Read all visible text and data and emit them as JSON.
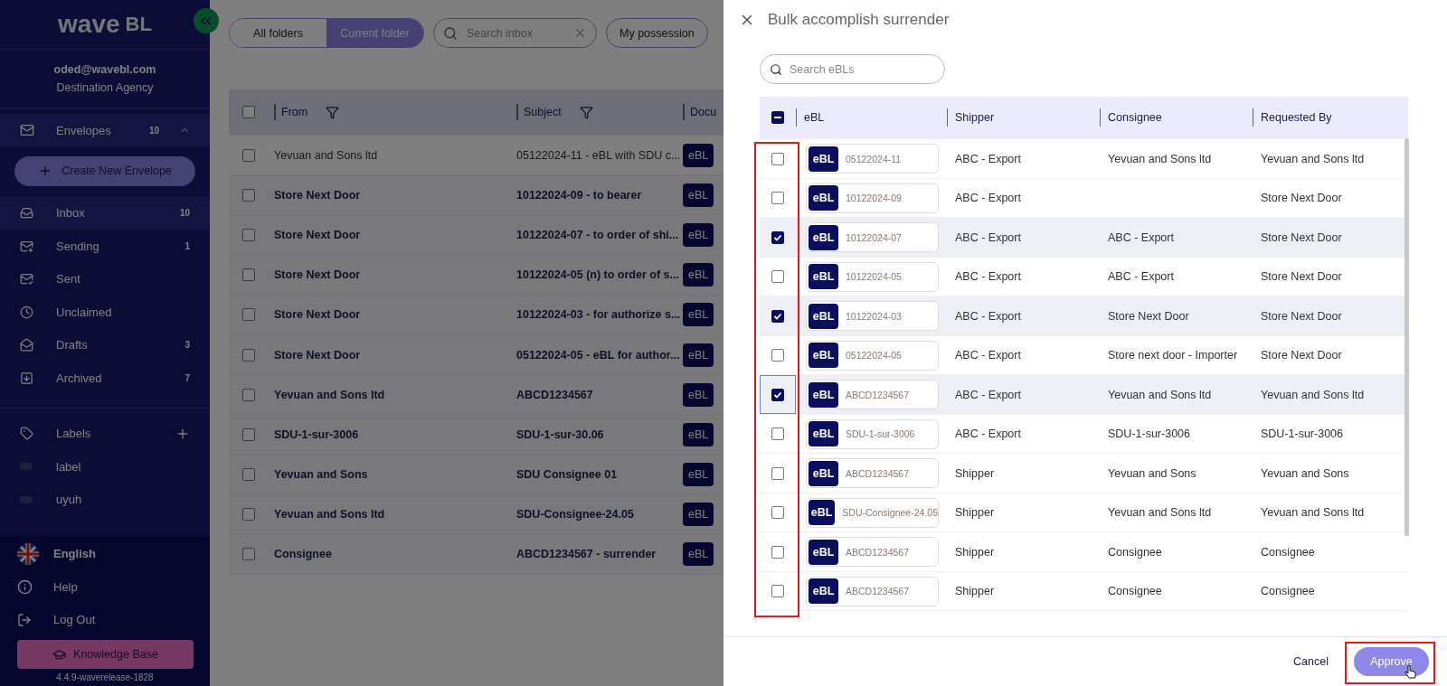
{
  "sidebar": {
    "logo": {
      "word": "wave",
      "suffix": "BL"
    },
    "user": {
      "email": "oded@wavebl.com",
      "organization": "Destination Agency"
    },
    "envelopes": {
      "label": "Envelopes",
      "count": "10",
      "expanded": true
    },
    "create_button": "Create New Envelope",
    "folders": [
      {
        "label": "Inbox",
        "count": "10",
        "selected": true
      },
      {
        "label": "Sending",
        "count": "1",
        "selected": false
      },
      {
        "label": "Sent",
        "selected": false
      },
      {
        "label": "Unclaimed",
        "selected": false
      },
      {
        "label": "Drafts",
        "count": "3",
        "selected": false
      },
      {
        "label": "Archived",
        "count": "7",
        "selected": false
      }
    ],
    "labels": {
      "title": "Labels",
      "items": [
        "label",
        "uyuh"
      ]
    },
    "footer": [
      "English",
      "Help",
      "Log Out"
    ],
    "knowledge_base": "Knowledge Base",
    "version": "4.4.9-waverelease-1828"
  },
  "main": {
    "scope_tabs": [
      {
        "label": "All folders",
        "selected": false
      },
      {
        "label": "Current folder",
        "selected": true
      }
    ],
    "search": {
      "placeholder": "Search inbox"
    },
    "filters": [
      "My possession"
    ],
    "table": {
      "select_all": {
        "checked": false
      },
      "columns": [
        "From",
        "Subject",
        "Docu"
      ],
      "rows": [
        {
          "from": "Yevuan and Sons ltd",
          "subject": "05122024-11 - eBL with SDU c...",
          "document": "eBL",
          "unread": false
        },
        {
          "from": "Store Next Door",
          "subject": "10122024-09 - to bearer",
          "document": "eBL",
          "unread": true
        },
        {
          "from": "Store Next Door",
          "subject": "10122024-07 - to order of shi...",
          "document": "eBL",
          "unread": true
        },
        {
          "from": "Store Next Door",
          "subject": "10122024-05 (n) to order of s...",
          "document": "eBL",
          "unread": true
        },
        {
          "from": "Store Next Door",
          "subject": "10122024-03 - for authorize s...",
          "document": "eBL",
          "unread": true
        },
        {
          "from": "Store Next Door",
          "subject": "05122024-05 - eBL for author...",
          "document": "eBL",
          "unread": true
        },
        {
          "from": "Yevuan and Sons ltd",
          "subject": "ABCD1234567",
          "document": "eBL",
          "unread": true
        },
        {
          "from": "SDU-1-sur-3006",
          "subject": "SDU-1-sur-30.06",
          "document": "eBL",
          "unread": true
        },
        {
          "from": "Yevuan and Sons",
          "subject": "SDU Consignee 01",
          "document": "eBL",
          "unread": true
        },
        {
          "from": "Yevuan and Sons ltd",
          "subject": "SDU-Consignee-24.05",
          "document": "eBL",
          "unread": true
        },
        {
          "from": "Consignee",
          "subject": "ABCD1234567 - surrender",
          "document": "eBL",
          "unread": true
        }
      ]
    }
  },
  "dialog": {
    "title": "Bulk accomplish surrender",
    "search": {
      "placeholder": "Search eBLs"
    },
    "select_all": {
      "indeterminate": true
    },
    "columns": [
      "eBL",
      "Shipper",
      "Consignee",
      "Requested By"
    ],
    "rows": [
      {
        "checked": false,
        "focused": false,
        "type": "eBL",
        "number": "05122024-11",
        "shipper": "ABC - Export",
        "consignee": "Yevuan and Sons ltd",
        "requested_by": "Yevuan and Sons ltd"
      },
      {
        "checked": false,
        "focused": false,
        "type": "eBL",
        "number": "10122024-09",
        "shipper": "ABC - Export",
        "requested_by": "Store Next Door"
      },
      {
        "checked": true,
        "focused": false,
        "type": "eBL",
        "number": "10122024-07",
        "shipper": "ABC - Export",
        "consignee": "ABC - Export",
        "requested_by": "Store Next Door"
      },
      {
        "checked": false,
        "focused": false,
        "type": "eBL",
        "number": "10122024-05",
        "shipper": "ABC - Export",
        "consignee": "ABC - Export",
        "requested_by": "Store Next Door"
      },
      {
        "checked": true,
        "focused": false,
        "type": "eBL",
        "number": "10122024-03",
        "shipper": "ABC - Export",
        "consignee": "Store Next Door",
        "requested_by": "Store Next Door"
      },
      {
        "checked": false,
        "focused": false,
        "type": "eBL",
        "number": "05122024-05",
        "shipper": "ABC - Export",
        "consignee": "Store next door - Importer",
        "requested_by": "Store Next Door"
      },
      {
        "checked": true,
        "focused": true,
        "type": "eBL",
        "number": "ABCD1234567",
        "shipper": "ABC - Export",
        "consignee": "Yevuan and Sons ltd",
        "requested_by": "Yevuan and Sons ltd"
      },
      {
        "checked": false,
        "focused": false,
        "type": "eBL",
        "number": "SDU-1-sur-3006",
        "shipper": "ABC - Export",
        "consignee": "SDU-1-sur-3006",
        "requested_by": "SDU-1-sur-3006"
      },
      {
        "checked": false,
        "focused": false,
        "type": "eBL",
        "number": "ABCD1234567",
        "shipper": "Shipper",
        "consignee": "Yevuan and Sons",
        "requested_by": "Yevuan and Sons"
      },
      {
        "checked": false,
        "focused": false,
        "type": "eBL",
        "number": "SDU-Consignee-24.05",
        "shipper": "Shipper",
        "consignee": "Yevuan and Sons ltd",
        "requested_by": "Yevuan and Sons ltd"
      },
      {
        "checked": false,
        "focused": false,
        "type": "eBL",
        "number": "ABCD1234567",
        "shipper": "Shipper",
        "consignee": "Consignee",
        "requested_by": "Consignee"
      },
      {
        "checked": false,
        "focused": false,
        "type": "eBL",
        "number": "ABCD1234567",
        "shipper": "Shipper",
        "consignee": "Consignee",
        "requested_by": "Consignee"
      }
    ],
    "cancel": "Cancel",
    "approve": "Approve"
  }
}
